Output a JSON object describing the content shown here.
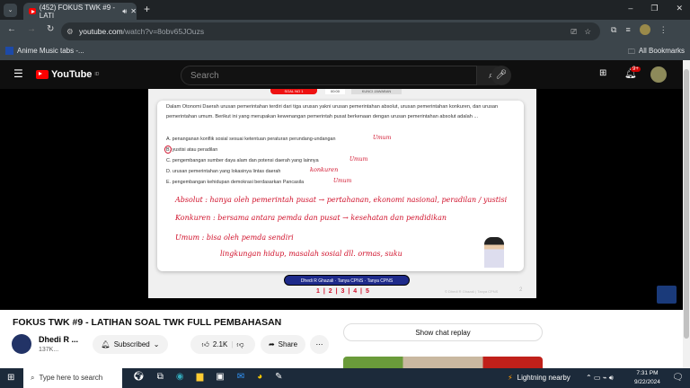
{
  "browser": {
    "tab_title": "(452) FOKUS TWK #9 - LATI",
    "url_host": "youtube.com",
    "url_path": "/watch?v=8obv65JOuzs",
    "bookmark": "Anime Music tabs -...",
    "all_bookmarks": "All Bookmarks"
  },
  "youtube": {
    "logo": "YouTube",
    "logo_suffix": "ID",
    "search_placeholder": "Search",
    "notif_badge": "9+"
  },
  "slide": {
    "tabs": [
      "SOAL NO 1",
      "00:00",
      "KUNCI JAWABAN"
    ],
    "question": "Dalam Otonomi Daerah urusan pemerintahan terdiri dari tiga urusan yakni urusan pemerintahan absolut, urusan pemerintahan konkuren, dan urusan pemerintahan umum. Berikut ini yang merupakan kewenangan pemerintah pusat berkenaan dengan urusan pemerintahan absolut adalah ...",
    "options": [
      {
        "text": "A. penanganan konflik sosial sesuai ketentuan peraturan perundang-undangan",
        "note": "Umum"
      },
      {
        "text": "B. yustisi atau peradilan",
        "note": ""
      },
      {
        "text": "C. pengembangan sumber daya alam dan potensi daerah yang lainnya",
        "note": "Umum"
      },
      {
        "text": "D. urusan pemerintahan yang lokasinya lintas daerah",
        "note": "konkuren"
      },
      {
        "text": "E. pengembangan kehidupan demokrasi berdasarkan Pancasila",
        "note": "Umum"
      }
    ],
    "handwriting": [
      "Absolut : hanya oleh pemerintah pusat → pertahanan, ekonomi nasional, peradilan / yustisi",
      "Konkuren : bersama antara pemda dan pusat → kesehatan dan pendidikan",
      "Umum : bisa oleh pemda sendiri",
      "lingkungan hidup, masalah sosial dll. ormas, suku"
    ],
    "social": [
      "Dhedi R Ghazali",
      "Tanya CPNS",
      "Tanya CPNS"
    ],
    "pages": "1 | 2 | 3 | 4 | 5",
    "watermark": "© Dhedi R Ghazali | Tanya CPNS",
    "slide_number": "2"
  },
  "video": {
    "title": "FOKUS TWK #9 - LATIHAN SOAL TWK FULL PEMBAHASAN",
    "channel": "Dhedi R ...",
    "subs": "137K...",
    "subscribed": "Subscribed",
    "likes": "2.1K",
    "share": "Share",
    "chat": "Show chat replay"
  },
  "taskbar": {
    "search": "Type here to search",
    "weather": "Lightning nearby",
    "time": "7:31 PM",
    "date": "9/22/2024"
  }
}
